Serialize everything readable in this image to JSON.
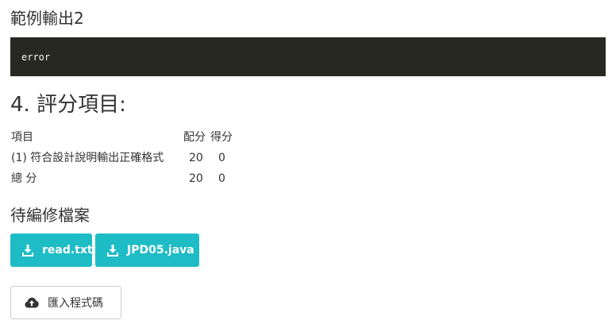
{
  "sample_output": {
    "heading": "範例輸出2",
    "code": "error"
  },
  "scoring": {
    "heading": "4. 評分項目:",
    "columns": {
      "item": "項目",
      "points": "配分",
      "earned": "得分"
    },
    "rows": [
      {
        "item": "(1) 符合設計說明輸出正確格式",
        "points": "20",
        "earned": "0"
      }
    ],
    "total": {
      "item": "總 分",
      "points": "20",
      "earned": "0"
    }
  },
  "files": {
    "heading": "待編修檔案",
    "downloads": [
      {
        "label": "read.txt",
        "icon": "download-icon"
      },
      {
        "label": "JPD05.java",
        "icon": "download-icon"
      }
    ]
  },
  "import_button": {
    "label": "匯入程式碼",
    "icon": "cloud-upload-icon"
  },
  "colors": {
    "code_bg": "#272822",
    "button_teal": "#1ebcc5",
    "text": "#333333"
  }
}
